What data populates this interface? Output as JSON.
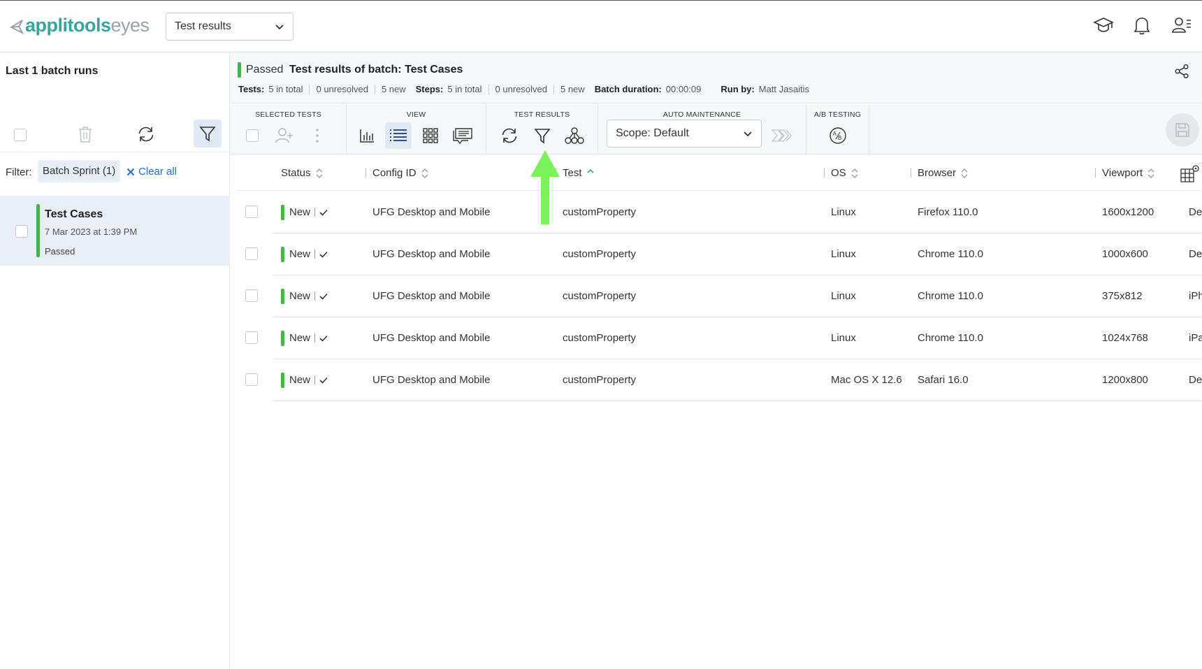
{
  "app": {
    "logo_primary": "applitools",
    "logo_secondary": "eyes",
    "view_select": "Test results"
  },
  "left_panel": {
    "title": "Last 1 batch runs",
    "filter_label": "Filter:",
    "filter_chip": "Batch Sprint (1)",
    "clear_all": "Clear all",
    "batch": {
      "name": "Test Cases",
      "date": "7 Mar 2023 at 1:39 PM",
      "status": "Passed"
    }
  },
  "header": {
    "status": "Passed",
    "title": "Test results of batch:  Test Cases",
    "stats": {
      "tests_label": "Tests:",
      "tests_total": "5 in total",
      "tests_unresolved": "0 unresolved",
      "tests_new": "5 new",
      "steps_label": "Steps:",
      "steps_total": "5 in total",
      "steps_unresolved": "0 unresolved",
      "steps_new": "5 new",
      "duration_label": "Batch duration:",
      "duration": "00:00:09",
      "run_by_label": "Run by:",
      "run_by": "Matt Jasaitis"
    }
  },
  "toolbar": {
    "selected_tests": "SELECTED TESTS",
    "view": "VIEW",
    "test_results": "TEST RESULTS",
    "auto_maintenance": "AUTO MAINTENANCE",
    "ab_testing": "A/B TESTING",
    "scope": "Scope: Default"
  },
  "table": {
    "columns": [
      "Status",
      "Config ID",
      "Test",
      "OS",
      "Browser",
      "Viewport"
    ],
    "rows": [
      {
        "status": "New",
        "config": "UFG Desktop and Mobile",
        "test": "customProperty",
        "os": "Linux",
        "browser": "Firefox 110.0",
        "viewport": "1600x1200",
        "extra": "De"
      },
      {
        "status": "New",
        "config": "UFG Desktop and Mobile",
        "test": "customProperty",
        "os": "Linux",
        "browser": "Chrome 110.0",
        "viewport": "1000x600",
        "extra": "De"
      },
      {
        "status": "New",
        "config": "UFG Desktop and Mobile",
        "test": "customProperty",
        "os": "Linux",
        "browser": "Chrome 110.0",
        "viewport": "375x812",
        "extra": "iPh"
      },
      {
        "status": "New",
        "config": "UFG Desktop and Mobile",
        "test": "customProperty",
        "os": "Linux",
        "browser": "Chrome 110.0",
        "viewport": "1024x768",
        "extra": "iPa"
      },
      {
        "status": "New",
        "config": "UFG Desktop and Mobile",
        "test": "customProperty",
        "os": "Mac OS X 12.6",
        "browser": "Safari 16.0",
        "viewport": "1200x800",
        "extra": "De"
      }
    ]
  },
  "colors": {
    "accent": "#3aa5a0",
    "passed": "#4cb050",
    "link": "#1f6ec9",
    "annotation_arrow": "#7cf25a"
  }
}
